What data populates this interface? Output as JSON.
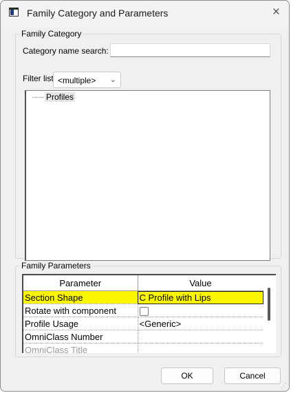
{
  "window": {
    "title": "Family Category and Parameters",
    "close_symbol": "×"
  },
  "family_category": {
    "group_label": "Family Category",
    "search_label": "Category name search:",
    "search_value": "",
    "filter_label": "Filter list:",
    "filter_value": "<multiple>",
    "tree_items": [
      "Profiles"
    ]
  },
  "family_parameters": {
    "group_label": "Family Parameters",
    "columns": [
      "Parameter",
      "Value"
    ],
    "rows": [
      {
        "parameter": "Section Shape",
        "value": "C Profile with Lips",
        "highlighted": true
      },
      {
        "parameter": "Rotate with component",
        "value": "",
        "checkbox": true
      },
      {
        "parameter": "Profile Usage",
        "value": "<Generic>"
      },
      {
        "parameter": "OmniClass Number",
        "value": ""
      },
      {
        "parameter": "OmniClass Title",
        "value": ""
      }
    ]
  },
  "buttons": {
    "ok": "OK",
    "cancel": "Cancel"
  },
  "colors": {
    "highlight": "#fbf700",
    "dialog_bg": "#f0f0f0"
  }
}
